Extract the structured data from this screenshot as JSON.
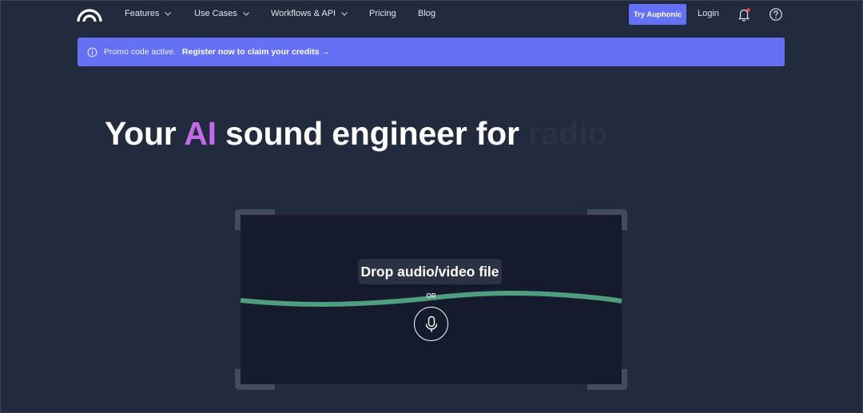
{
  "nav": {
    "items": [
      {
        "label": "Features",
        "dropdown": true
      },
      {
        "label": "Use Cases",
        "dropdown": true
      },
      {
        "label": "Workflows & API",
        "dropdown": true
      },
      {
        "label": "Pricing",
        "dropdown": false
      },
      {
        "label": "Blog",
        "dropdown": false
      }
    ],
    "try_label": "Try Auphonic",
    "login_label": "Login",
    "icons": [
      "auphonic-logo-icon",
      "bell-icon",
      "help-circle-icon"
    ],
    "notification_dot_color": "#ef4444"
  },
  "promo": {
    "text": "Promo code active.",
    "link": "Register now to claim your credits →",
    "background": "#6571f4"
  },
  "hero": {
    "prefix": "Your ",
    "highlight": "AI",
    "middle": " sound engineer for ",
    "rotating_word": "radio",
    "highlight_color": "#c56ae6"
  },
  "dropzone": {
    "drop_label": "Drop audio/video file",
    "or_label": "OR",
    "wave_color": "#4f9e80"
  }
}
